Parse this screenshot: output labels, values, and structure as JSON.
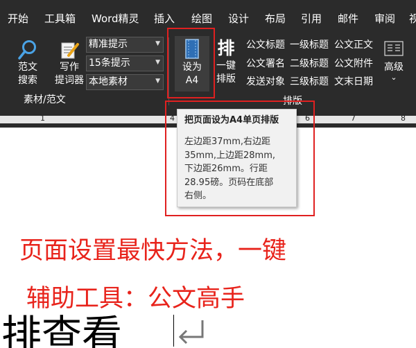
{
  "menu": {
    "tabs": [
      "开始",
      "工具箱",
      "Word精灵",
      "插入",
      "绘图",
      "设计",
      "布局",
      "引用",
      "邮件",
      "审阅",
      "视"
    ]
  },
  "ribbon": {
    "search_button": {
      "line1": "范文",
      "line2": "搜索"
    },
    "writing_button": {
      "line1": "写作",
      "line2": "提词器"
    },
    "combos": [
      "精准提示",
      "15条提示",
      "本地素材"
    ],
    "group_material_label": "素材/范文",
    "a4_button": {
      "line1": "设为",
      "line2": "A4"
    },
    "onekey_button": {
      "big": "排",
      "line1": "一键",
      "line2": "排版"
    },
    "format_items": [
      [
        "公文标题",
        "一级标题",
        "公文正文"
      ],
      [
        "公文署名",
        "二级标题",
        "公文附件"
      ],
      [
        "发送对象",
        "三级标题",
        "文末日期"
      ]
    ],
    "advanced_button": {
      "label": "高级",
      "chevron": "⌄"
    },
    "group_layout_label": "排版",
    "accent_border": "#e02020"
  },
  "ruler": {
    "numbers": [
      "1",
      "4",
      "6",
      "7",
      "8"
    ]
  },
  "tooltip": {
    "title": "把页面设为A4单页排版",
    "body": "左边距37mm,右边距\n35mm,上边距28mm,\n下边距26mm。行距\n28.95磅。页码在底部\n右侧。"
  },
  "document": {
    "caption_line1": "页面设置最快方法，一键",
    "caption_line2": "辅助工具：公文高手",
    "body_text": "排查看",
    "caption_color": "#e8231b"
  }
}
